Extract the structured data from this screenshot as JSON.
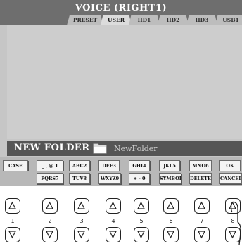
{
  "screen": {
    "title": "VOICE (RIGHT1)",
    "tabs": [
      {
        "label": "PRESET",
        "active": false
      },
      {
        "label": "USER",
        "active": true
      },
      {
        "label": "HD1",
        "active": false
      },
      {
        "label": "HD2",
        "active": false
      },
      {
        "label": "HD3",
        "active": false
      },
      {
        "label": "USB1",
        "active": false
      }
    ]
  },
  "new_folder": {
    "label": "NEW FOLDER",
    "value": "NewFolder_",
    "icon": "folder-icon"
  },
  "keyboard": {
    "row1": [
      "CASE",
      "_ , @ 1",
      "ABC2",
      "DEF3",
      "GHI4",
      "JKL5",
      "MNO6",
      "OK"
    ],
    "row2": [
      "PQRS7",
      "TUV8",
      "WXYZ9",
      "+ - 0",
      "SYMBOL",
      "DELETE",
      "CANCEL"
    ]
  },
  "panel": {
    "numbers": [
      "1",
      "2",
      "3",
      "4",
      "5",
      "6",
      "7",
      "8"
    ],
    "up_icon": "triangle-up-icon",
    "down_icon": "triangle-down-icon",
    "pointer_icon": "hand-pointer-icon"
  }
}
